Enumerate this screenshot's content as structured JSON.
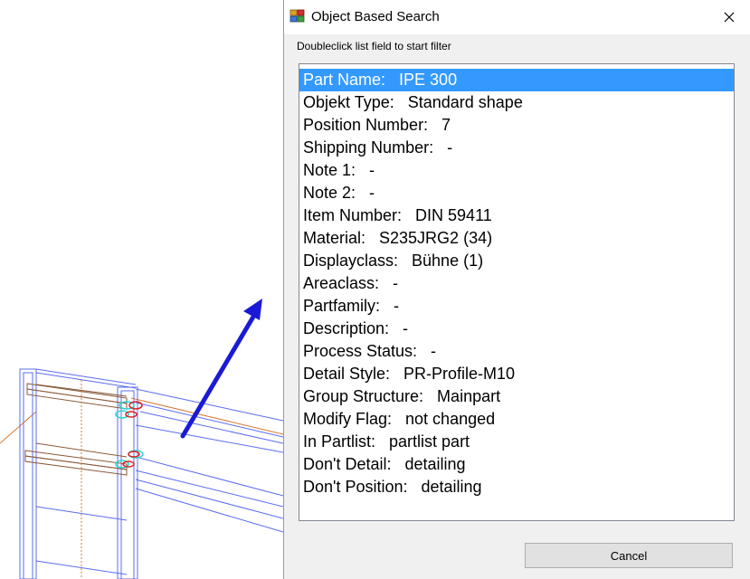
{
  "dialog": {
    "title": "Object Based Search",
    "hint": "Doubleclick list field to start filter",
    "cancel_label": "Cancel",
    "items": [
      "Part Name:   IPE 300",
      "Objekt Type:   Standard shape",
      "Position Number:   7",
      "Shipping Number:   -",
      "Note 1:   -",
      "Note 2:   -",
      "Item Number:   DIN 59411",
      "Material:   S235JRG2 (34)",
      "Displayclass:   Bühne (1)",
      "Areaclass:   -",
      "Partfamily:   -",
      "Description:   -",
      "Process Status:   -",
      "Detail Style:   PR-Profile-M10",
      "Group Structure:   Mainpart",
      "Modify Flag:   not changed",
      "In Partlist:   partlist part",
      "Don't Detail:   detailing",
      "Don't Position:   detailing"
    ],
    "selected_index": 0
  },
  "colors": {
    "selection": "#3399ff",
    "arrow": "#1a1ad6",
    "wireframe_blue": "#5a6cf0",
    "wireframe_orange": "#d9782a",
    "bolt_cyan": "#2ad4d4",
    "bolt_red": "#e02020"
  },
  "icons": [
    "app-icon",
    "close-icon"
  ]
}
